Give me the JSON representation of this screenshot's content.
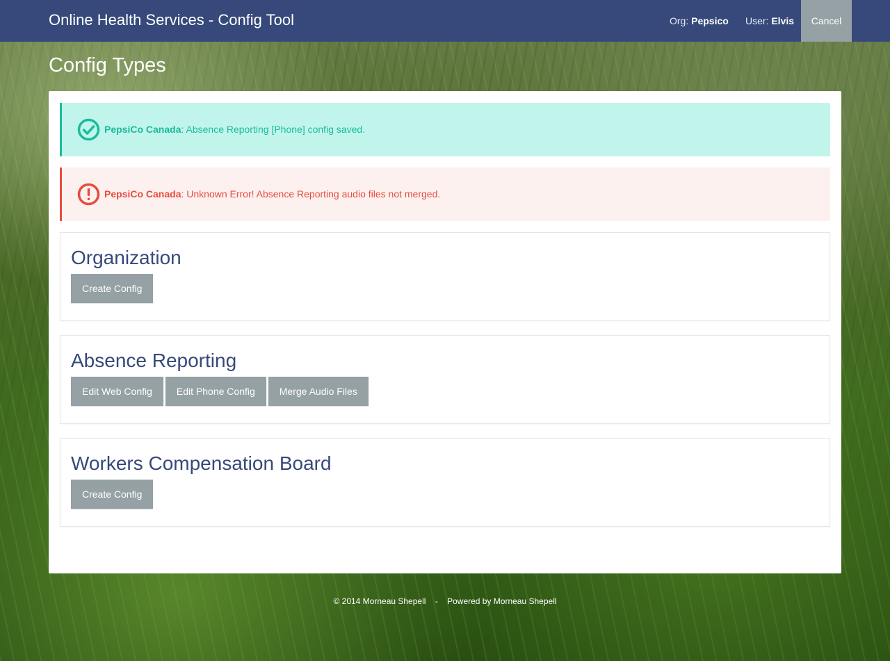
{
  "header": {
    "title": "Online Health Services - Config Tool",
    "org_label": "Org:",
    "org_value": "Pepsico",
    "user_label": "User:",
    "user_value": "Elvis",
    "cancel_label": "Cancel"
  },
  "page": {
    "title": "Config Types"
  },
  "alerts": {
    "success": {
      "org": "PepsiCo Canada",
      "message": ": Absence Reporting [Phone] config saved.",
      "icon": "check-circle-icon",
      "color": "#1abc9c"
    },
    "error": {
      "org": "PepsiCo Canada",
      "message": ": Unknown Error! Absence Reporting audio files not merged.",
      "icon": "exclamation-circle-icon",
      "color": "#e74c3c"
    }
  },
  "sections": [
    {
      "title": "Organization",
      "buttons": [
        "Create Config"
      ]
    },
    {
      "title": "Absence Reporting",
      "buttons": [
        "Edit Web Config",
        "Edit Phone Config",
        "Merge Audio Files"
      ]
    },
    {
      "title": "Workers Compensation Board",
      "buttons": [
        "Create Config"
      ]
    }
  ],
  "footer": {
    "copyright": "© 2014 Morneau Shepell",
    "separator": "-",
    "powered_by": "Powered by Morneau Shepell"
  },
  "colors": {
    "header_bg": "#36497a",
    "button_bg": "#95a1a4",
    "heading": "#36497a"
  }
}
